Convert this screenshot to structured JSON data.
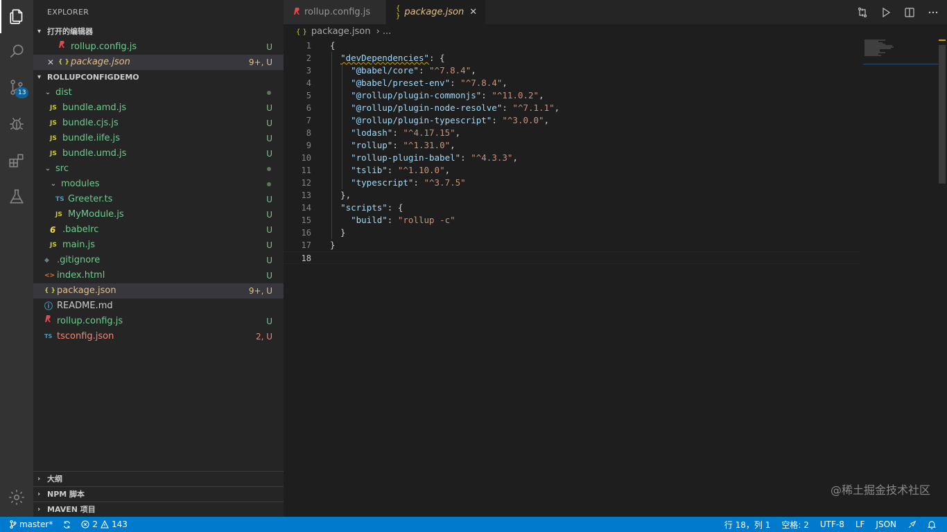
{
  "sidebar": {
    "title": "EXPLORER",
    "open_editors": {
      "title": "打开的编辑器",
      "items": [
        {
          "icon": "rollup",
          "name": "rollup.config.js",
          "status": "U"
        },
        {
          "icon": "{ }",
          "name": "package.json",
          "status": "9+, U",
          "close": "✕"
        }
      ]
    },
    "project": {
      "title": "ROLLUPCONFIGDEMO",
      "items": [
        {
          "name": "dist"
        },
        {
          "icon": "JS",
          "name": "bundle.amd.js",
          "status": "U"
        },
        {
          "icon": "JS",
          "name": "bundle.cjs.js",
          "status": "U"
        },
        {
          "icon": "JS",
          "name": "bundle.iife.js",
          "status": "U"
        },
        {
          "icon": "JS",
          "name": "bundle.umd.js",
          "status": "U"
        },
        {
          "name": "src"
        },
        {
          "name": "modules"
        },
        {
          "icon": "TS",
          "name": "Greeter.ts",
          "status": "U"
        },
        {
          "icon": "JS",
          "name": "MyModule.js",
          "status": "U"
        },
        {
          "icon": "6",
          "name": ".babelrc",
          "status": "U"
        },
        {
          "icon": "JS",
          "name": "main.js",
          "status": "U"
        },
        {
          "icon": "◆",
          "name": ".gitignore",
          "status": "U"
        },
        {
          "icon": "<>",
          "name": "index.html",
          "status": "U"
        },
        {
          "icon": "{ }",
          "name": "package.json",
          "status": "9+, U"
        },
        {
          "icon": "ⓘ",
          "name": "README.md"
        },
        {
          "icon": "rollup",
          "name": "rollup.config.js",
          "status": "U"
        },
        {
          "icon": "TS",
          "name": "tsconfig.json",
          "status": "2, U"
        }
      ]
    },
    "bottom": [
      {
        "label": "大纲"
      },
      {
        "label": "NPM 脚本"
      },
      {
        "label": "MAVEN 项目"
      }
    ]
  },
  "activity": {
    "items": [
      "explorer-icon",
      "search-icon",
      "source-control-icon",
      "debug-icon",
      "extensions-icon",
      "testing-icon",
      "settings-gear-icon"
    ],
    "scm_badge": "13"
  },
  "tabs": [
    {
      "label": "rollup.config.js",
      "icon": "rollup",
      "active": false
    },
    {
      "label": "package.json",
      "icon": "{ }",
      "active": true,
      "close": "✕"
    }
  ],
  "breadcrumb": {
    "icon": "{ }",
    "file": "package.json",
    "sep": "›",
    "rest": "..."
  },
  "code": {
    "line_numbers": [
      "1",
      "2",
      "3",
      "4",
      "5",
      "6",
      "7",
      "8",
      "9",
      "10",
      "11",
      "12",
      "13",
      "14",
      "15",
      "16",
      "17",
      "18"
    ],
    "lines": [
      [
        {
          "t": "p",
          "v": "{"
        }
      ],
      [
        {
          "t": "p",
          "v": "  "
        },
        {
          "t": "k",
          "v": "\"devDependencies\"",
          "squig": true
        },
        {
          "t": "p",
          "v": ": {"
        }
      ],
      [
        {
          "t": "p",
          "v": "    "
        },
        {
          "t": "k",
          "v": "\"@babel/core\""
        },
        {
          "t": "p",
          "v": ": "
        },
        {
          "t": "s",
          "v": "\"^7.8.4\""
        },
        {
          "t": "p",
          "v": ","
        }
      ],
      [
        {
          "t": "p",
          "v": "    "
        },
        {
          "t": "k",
          "v": "\"@babel/preset-env\""
        },
        {
          "t": "p",
          "v": ": "
        },
        {
          "t": "s",
          "v": "\"^7.8.4\""
        },
        {
          "t": "p",
          "v": ","
        }
      ],
      [
        {
          "t": "p",
          "v": "    "
        },
        {
          "t": "k",
          "v": "\"@rollup/plugin-commonjs\""
        },
        {
          "t": "p",
          "v": ": "
        },
        {
          "t": "s",
          "v": "\"^11.0.2\""
        },
        {
          "t": "p",
          "v": ","
        }
      ],
      [
        {
          "t": "p",
          "v": "    "
        },
        {
          "t": "k",
          "v": "\"@rollup/plugin-node-resolve\""
        },
        {
          "t": "p",
          "v": ": "
        },
        {
          "t": "s",
          "v": "\"^7.1.1\""
        },
        {
          "t": "p",
          "v": ","
        }
      ],
      [
        {
          "t": "p",
          "v": "    "
        },
        {
          "t": "k",
          "v": "\"@rollup/plugin-typescript\""
        },
        {
          "t": "p",
          "v": ": "
        },
        {
          "t": "s",
          "v": "\"^3.0.0\""
        },
        {
          "t": "p",
          "v": ","
        }
      ],
      [
        {
          "t": "p",
          "v": "    "
        },
        {
          "t": "k",
          "v": "\"lodash\""
        },
        {
          "t": "p",
          "v": ": "
        },
        {
          "t": "s",
          "v": "\"^4.17.15\""
        },
        {
          "t": "p",
          "v": ","
        }
      ],
      [
        {
          "t": "p",
          "v": "    "
        },
        {
          "t": "k",
          "v": "\"rollup\""
        },
        {
          "t": "p",
          "v": ": "
        },
        {
          "t": "s",
          "v": "\"^1.31.0\""
        },
        {
          "t": "p",
          "v": ","
        }
      ],
      [
        {
          "t": "p",
          "v": "    "
        },
        {
          "t": "k",
          "v": "\"rollup-plugin-babel\""
        },
        {
          "t": "p",
          "v": ": "
        },
        {
          "t": "s",
          "v": "\"^4.3.3\""
        },
        {
          "t": "p",
          "v": ","
        }
      ],
      [
        {
          "t": "p",
          "v": "    "
        },
        {
          "t": "k",
          "v": "\"tslib\""
        },
        {
          "t": "p",
          "v": ": "
        },
        {
          "t": "s",
          "v": "\"^1.10.0\""
        },
        {
          "t": "p",
          "v": ","
        }
      ],
      [
        {
          "t": "p",
          "v": "    "
        },
        {
          "t": "k",
          "v": "\"typescript\""
        },
        {
          "t": "p",
          "v": ": "
        },
        {
          "t": "s",
          "v": "\"^3.7.5\""
        }
      ],
      [
        {
          "t": "p",
          "v": "  },"
        }
      ],
      [
        {
          "t": "p",
          "v": "  "
        },
        {
          "t": "k",
          "v": "\"scripts\""
        },
        {
          "t": "p",
          "v": ": {"
        }
      ],
      [
        {
          "t": "p",
          "v": "    "
        },
        {
          "t": "k",
          "v": "\"build\""
        },
        {
          "t": "p",
          "v": ": "
        },
        {
          "t": "s",
          "v": "\"rollup -c\""
        }
      ],
      [
        {
          "t": "p",
          "v": "  }"
        }
      ],
      [
        {
          "t": "p",
          "v": "}"
        }
      ],
      []
    ]
  },
  "watermark": "@稀土掘金技术社区",
  "statusbar": {
    "branch": "master*",
    "errors": "2",
    "warnings": "143",
    "position": "行 18，列 1",
    "spaces": "空格: 2",
    "encoding": "UTF-8",
    "eol": "LF",
    "language": "JSON"
  }
}
